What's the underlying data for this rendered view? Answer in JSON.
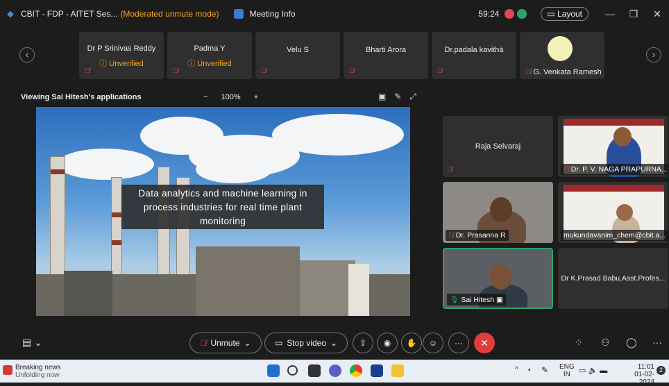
{
  "window": {
    "title": "CBIT - FDP - AITET Ses...",
    "mode": "(Moderated unmute mode)",
    "meeting_info": "Meeting Info",
    "timer": "59:24",
    "layout_label": "Layout"
  },
  "participants_strip": [
    {
      "name": "Dr P Srinivas Reddy",
      "status": "Unverified"
    },
    {
      "name": "Padma Y",
      "status": "Unverified"
    },
    {
      "name": "Velu S",
      "status": ""
    },
    {
      "name": "Bharti Arora",
      "status": ""
    },
    {
      "name": "Dr.padala kavithà",
      "status": ""
    },
    {
      "name": "G. Venkata Ramesh",
      "status": ""
    }
  ],
  "share": {
    "viewing_label": "Viewing Sai Hitesh's applications",
    "zoom_minus": "−",
    "zoom_level": "100%",
    "zoom_plus": "+",
    "slide_text": "Data analytics and machine learning in process industries for real time plant monitoring"
  },
  "video_grid": [
    {
      "name": "Raja Selvaraj"
    },
    {
      "name": "Dr. P. V. NAGA PRAPURNA..."
    },
    {
      "name": "Dr. Prasanna R"
    },
    {
      "name": "mukundavanim_chem@cbit.a..."
    },
    {
      "name": "Sai Hitesh"
    },
    {
      "name": "Dr K.Prasad Babu,Asst.Profes..."
    }
  ],
  "controls": {
    "unmute": "Unmute",
    "stop_video": "Stop video"
  },
  "taskbar": {
    "news_title": "Breaking news",
    "news_sub": "Unfolding now",
    "lang1": "ENG",
    "lang2": "IN",
    "time": "11:01",
    "date": "01-02-2024",
    "badge": "2"
  },
  "colors": {
    "unverified": "#f5a623",
    "muted": "#e5484d",
    "active_speaker": "#2ea36b",
    "leave": "#e03c3c"
  }
}
